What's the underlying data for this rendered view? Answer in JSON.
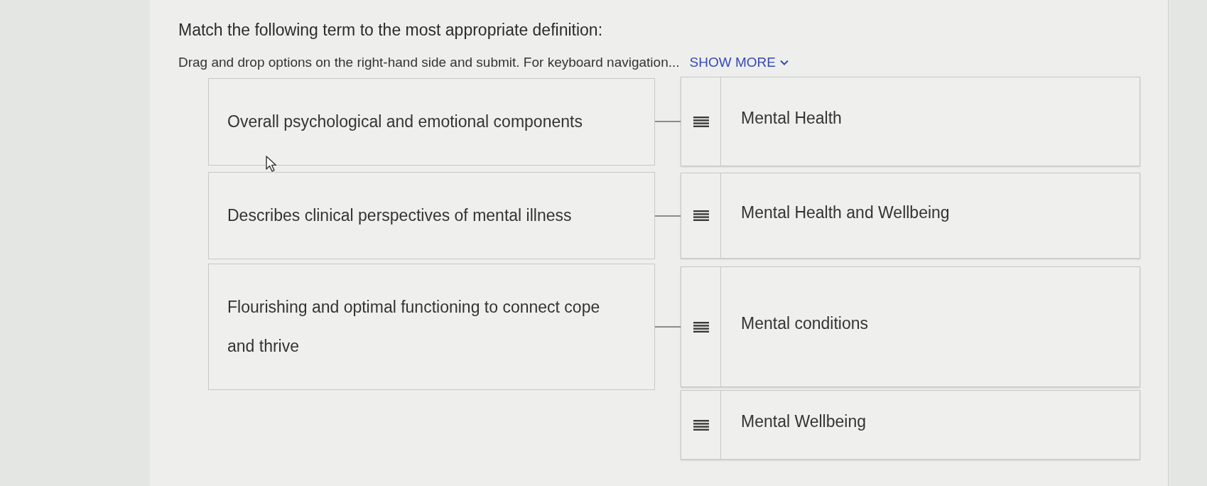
{
  "question": {
    "title": "Match the following term to the most appropriate definition:",
    "instructions": "Drag and drop options on the right-hand side and submit. For keyboard navigation...",
    "show_more": "SHOW MORE"
  },
  "terms": [
    "Overall psychological and emotional components",
    "Describes clinical perspectives of mental illness",
    "Flourishing and optimal functioning to connect cope and thrive"
  ],
  "options": [
    "Mental Health",
    "Mental Health and Wellbeing",
    "Mental conditions",
    "Mental Wellbeing"
  ]
}
